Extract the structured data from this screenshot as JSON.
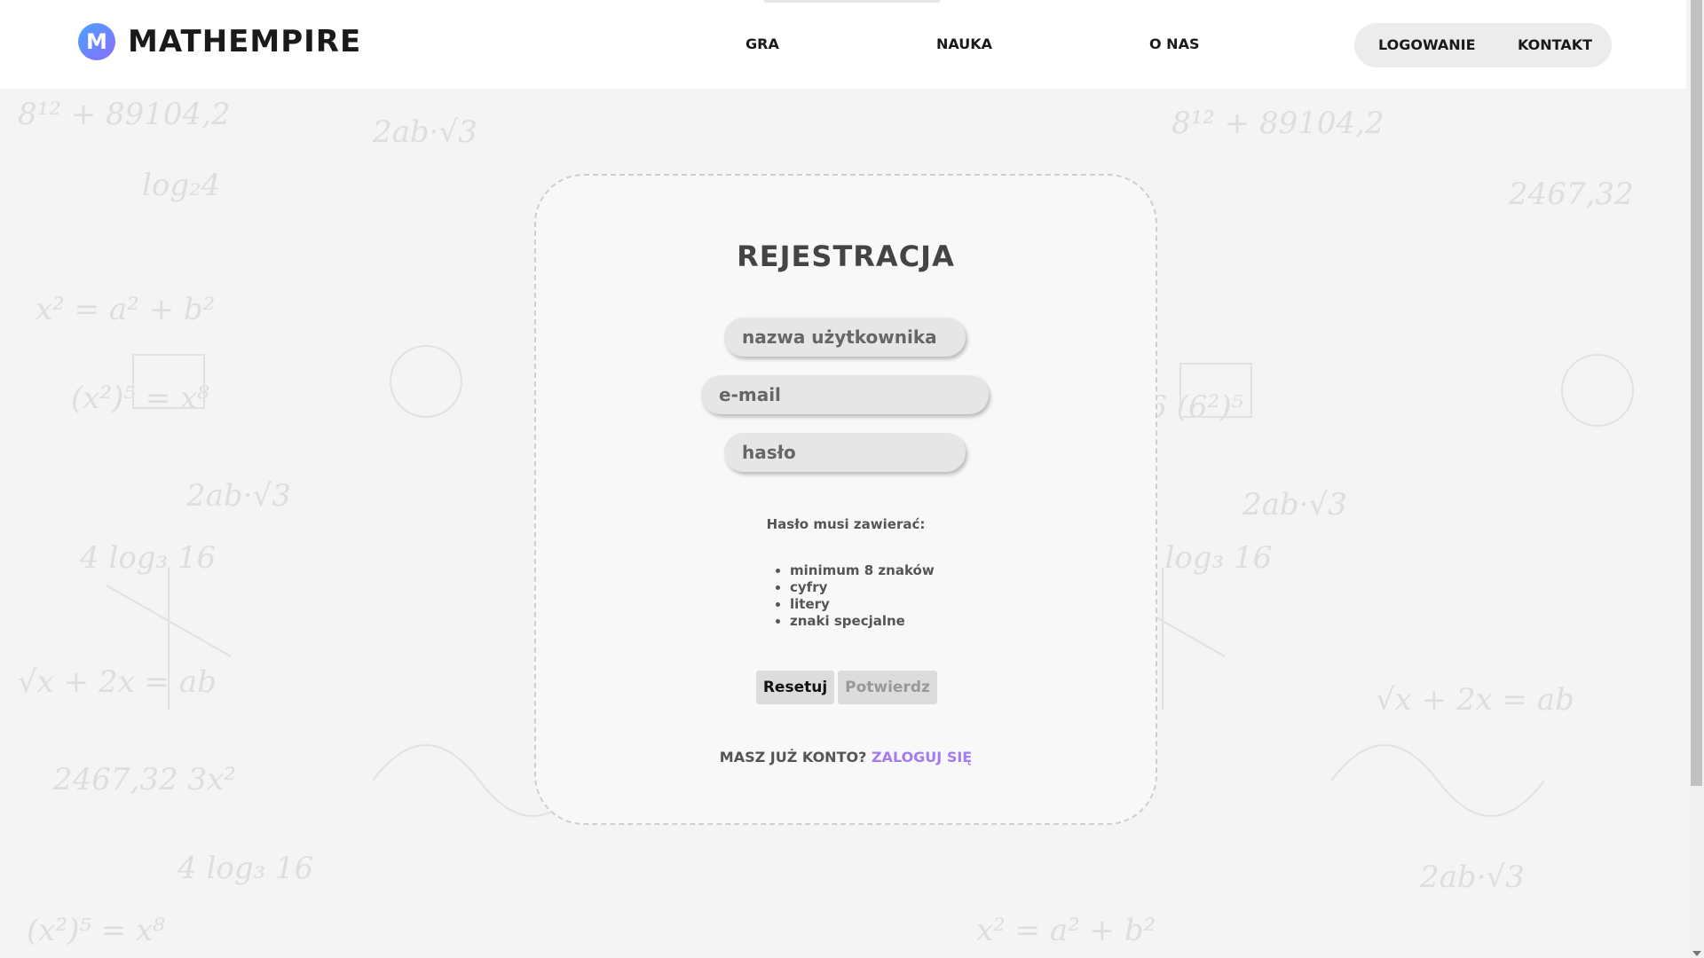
{
  "brand": {
    "logo_letter": "M",
    "name": "MATHEMPIRE",
    "colors": {
      "logo_start": "#4aa3ff",
      "logo_end": "#8a6cff"
    }
  },
  "nav": {
    "items": [
      {
        "label": "GRA"
      },
      {
        "label": "NAUKA"
      },
      {
        "label": "O NAS"
      }
    ],
    "auth": {
      "login_label": "LOGOWANIE",
      "contact_label": "KONTAKT"
    }
  },
  "registration": {
    "title": "REJESTRACJA",
    "username_placeholder": "nazwa użytkownika",
    "email_placeholder": "e-mail",
    "password_placeholder": "hasło",
    "password_rules_heading": "Hasło musi zawierać:",
    "password_rules": [
      "minimum 8 znaków",
      "cyfry",
      "litery",
      "znaki specjalne"
    ],
    "reset_label": "Resetuj",
    "confirm_label": "Potwierdz",
    "have_account_text": "MASZ JUŻ KONTO?",
    "login_link_label": "ZALOGUJ SIĘ",
    "link_color": "#a57cf0"
  },
  "icons": [
    "logo-icon",
    "scroll-down-arrow-icon"
  ]
}
